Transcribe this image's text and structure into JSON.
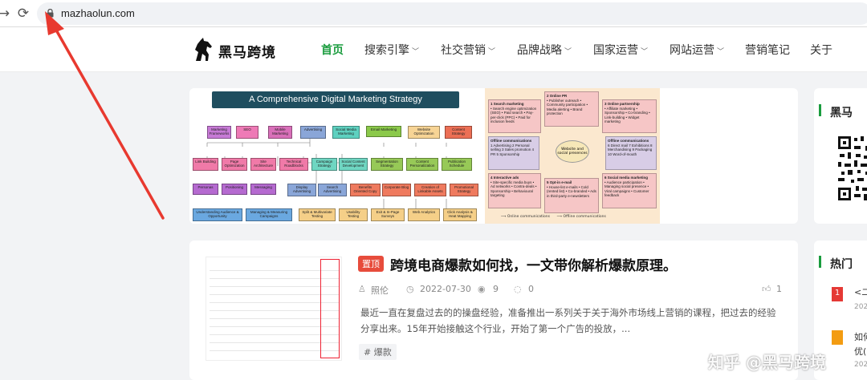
{
  "browser": {
    "url": "mazhaolun.com",
    "back_icon": "arrow-right-icon",
    "reload_icon": "reload-icon"
  },
  "site": {
    "logo_text": "黑马跨境",
    "nav": [
      {
        "label": "首页",
        "active": true,
        "dropdown": false
      },
      {
        "label": "搜索引擎",
        "active": false,
        "dropdown": true
      },
      {
        "label": "社交营销",
        "active": false,
        "dropdown": true
      },
      {
        "label": "品牌战略",
        "active": false,
        "dropdown": true
      },
      {
        "label": "国家运营",
        "active": false,
        "dropdown": true
      },
      {
        "label": "网站运营",
        "active": false,
        "dropdown": true
      },
      {
        "label": "营销笔记",
        "active": false,
        "dropdown": false
      },
      {
        "label": "关于",
        "active": false,
        "dropdown": false
      }
    ],
    "accent_color": "#1a9c3e"
  },
  "banner": {
    "title": "A Comprehensive Digital Marketing Strategy",
    "mindmap": {
      "row1": [
        "Marketing Frameworks",
        "SEO",
        "Mobile Marketing",
        "Advertising",
        "Social Media Marketing",
        "Email Marketing",
        "Website Optimization",
        "Content Strategy"
      ],
      "row2": [
        "Link Building",
        "Page Optimization",
        "Site Architecture",
        "Technical Roadblocks",
        "Campaign Strategy",
        "Social Content Development",
        "Segmentation Strategy",
        "Content Personalization",
        "Publication Schedule"
      ],
      "row3": [
        "Personas",
        "Positioning",
        "Messaging",
        "Display Advertising",
        "Search Advertising",
        "Benefits Oriented Copy",
        "Corporate Blog",
        "Creation of Linkable Assets",
        "Promotional Strategy"
      ],
      "row4": [
        "Understanding Audience & Opportunity",
        "Managing & Measuring Campaigns",
        "Split & Multivariate Testing",
        "Usability Testing",
        "Exit & In-Page Surveys",
        "Web Analytics",
        "Click Analysis & Heat Mapping"
      ]
    },
    "grid": {
      "center": "Website and social presences",
      "cells": [
        {
          "title": "1 Search marketing",
          "items": "• Search engine optimization (SEO) • Paid search • Pay-per-click (PPC) • Paid for inclusion feeds"
        },
        {
          "title": "2 Online PR",
          "items": "• Publisher outreach • Community participation • Media alerting • Brand protection"
        },
        {
          "title": "3 Online partnership",
          "items": "• Affiliate marketing • Sponsorship • Co-branding • Link-building • Widget marketing"
        },
        {
          "title": "Offline communications",
          "items": "1 Advertising 2 Personal selling 3 Sales promotion 4 PR 5 Sponsorship"
        },
        {
          "title": "Offline communications",
          "items": "6 Direct mail 7 Exhibitions 8 Merchandising 9 Packaging 10 Word-of-mouth"
        },
        {
          "title": "4 Interactive ads",
          "items": "• Site-specific media buys • Ad networks • Contra-deals • Sponsorship • Behavioural targeting"
        },
        {
          "title": "5 Opt-in e-mail",
          "items": "• House-list e-mails • Cold (rented list) • Co-branded • Ads in third-party e-newsletters"
        },
        {
          "title": "6 Social media marketing",
          "items": "• Audience participation • Managing social presence • Viral campaigns • Customer feedback"
        }
      ],
      "legend": [
        "Online communications",
        "Offline communications"
      ]
    }
  },
  "side_card": {
    "title": "黑马"
  },
  "article": {
    "badge": "置顶",
    "title": "跨境电商爆款如何找，一文带你解析爆款原理。",
    "author": "照伦",
    "date": "2022-07-30",
    "views": "9",
    "comments": "0",
    "likes": "1",
    "excerpt": "最近一直在复盘过去的的操盘经验，准备推出一系列关于关于海外市场线上营销的课程，把过去的经验分享出来。15年开始接触这个行业，开始了第一个广告的投放，...",
    "tag": "# 爆款"
  },
  "hot_card": {
    "title": "热门",
    "items": [
      {
        "rank": "1",
        "text": "<二",
        "date": "202"
      },
      {
        "rank": "",
        "text": "如何",
        "text2": "优(",
        "date": "202"
      }
    ]
  },
  "watermark": "知乎 @黑马跨境"
}
